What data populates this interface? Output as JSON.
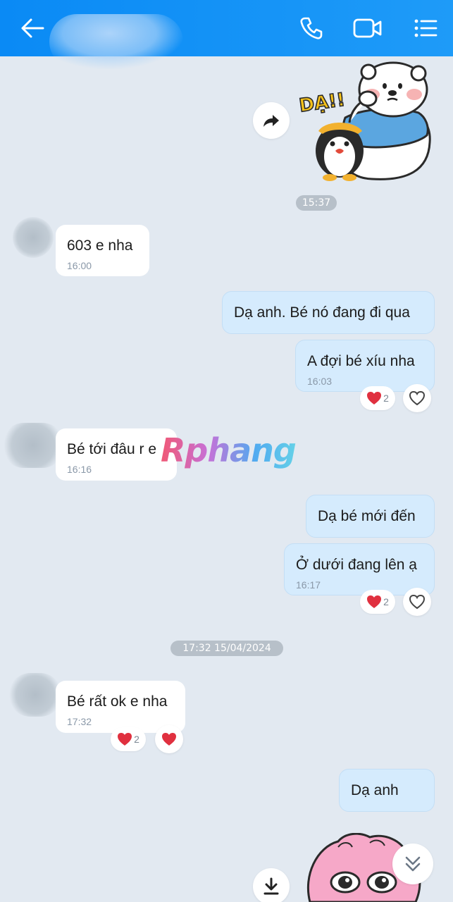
{
  "header": {
    "back_icon": "arrow-left-icon",
    "call_icon": "phone-icon",
    "video_icon": "video-camera-icon",
    "menu_icon": "list-menu-icon"
  },
  "sticker_top": {
    "caption": "DẠ!!",
    "forward_icon": "forward-arrow-icon"
  },
  "timestamps": [
    "15:37",
    "17:32 15/04/2024"
  ],
  "messages": [
    {
      "side": "in",
      "text": "603 e nha",
      "time": "16:00"
    },
    {
      "side": "out",
      "text": "Dạ anh. Bé nó đang đi qua",
      "time": ""
    },
    {
      "side": "out",
      "text": "A đợi bé xíu nha",
      "time": "16:03",
      "reaction_count": "2"
    },
    {
      "side": "in",
      "text": "Bé tới đâu r e",
      "time": "16:16"
    },
    {
      "side": "out",
      "text": "Dạ bé mới đến",
      "time": ""
    },
    {
      "side": "out",
      "text": "Ở dưới đang lên ạ",
      "time": "16:17",
      "reaction_count": "2"
    },
    {
      "side": "in",
      "text": "Bé rất ok e nha",
      "time": "17:32",
      "reaction_count": "2"
    },
    {
      "side": "out",
      "text": "Dạ anh",
      "time": ""
    }
  ],
  "watermark": "Rphang",
  "colors": {
    "header": "#0a8af5",
    "background": "#e2e9f1",
    "outgoing_bubble": "#d5ebfd",
    "incoming_bubble": "#ffffff",
    "heart": "#e0303f"
  }
}
